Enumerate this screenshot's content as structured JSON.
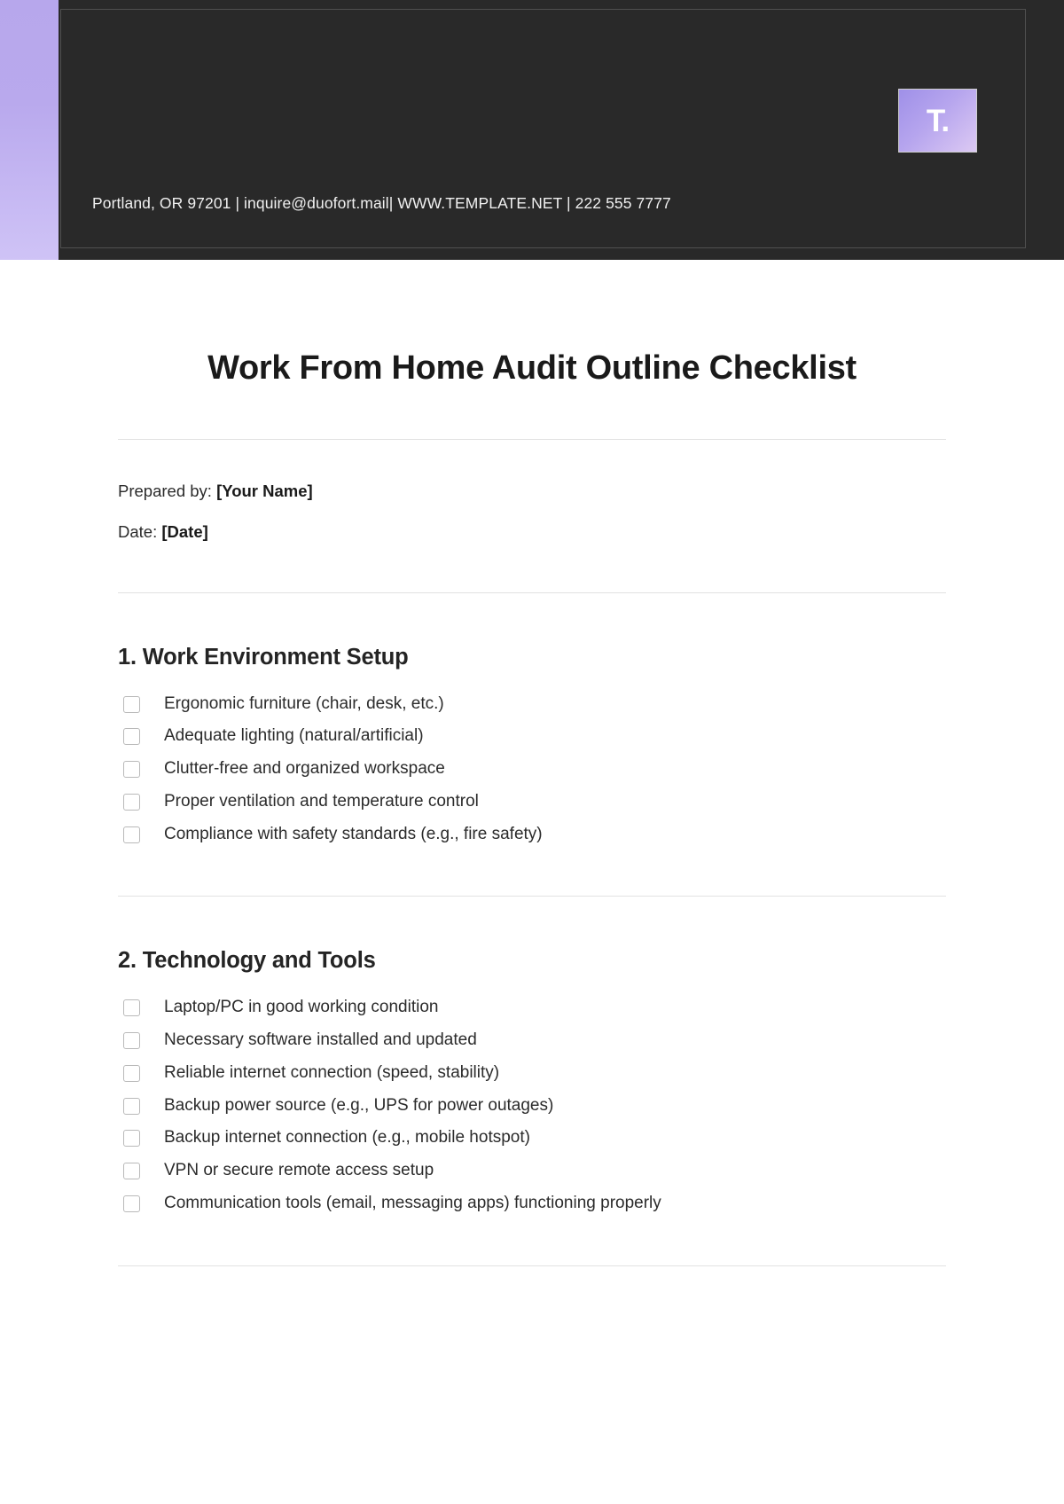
{
  "header": {
    "logo_text": "T.",
    "logo_name": "template-net-logo",
    "contact_line": "Portland, OR 97201 | inquire@duofort.mail| WWW.TEMPLATE.NET | 222 555 7777",
    "accent_color": "#b7a7ec",
    "band_color": "#292929"
  },
  "document": {
    "title": "Work From Home Audit Outline Checklist",
    "prepared_by_label": "Prepared by:",
    "prepared_by_value": "[Your Name]",
    "date_label": "Date:",
    "date_value": "[Date]"
  },
  "sections": [
    {
      "heading": "1. Work Environment Setup",
      "items": [
        "Ergonomic furniture (chair, desk, etc.)",
        "Adequate lighting (natural/artificial)",
        "Clutter-free and organized workspace",
        "Proper ventilation and temperature control",
        "Compliance with safety standards (e.g., fire safety)"
      ]
    },
    {
      "heading": "2. Technology and Tools",
      "items": [
        "Laptop/PC in good working condition",
        "Necessary software installed and updated",
        "Reliable internet connection (speed, stability)",
        "Backup power source (e.g., UPS for power outages)",
        "Backup internet connection (e.g., mobile hotspot)",
        "VPN or secure remote access setup",
        "Communication tools (email, messaging apps) functioning properly"
      ]
    }
  ]
}
